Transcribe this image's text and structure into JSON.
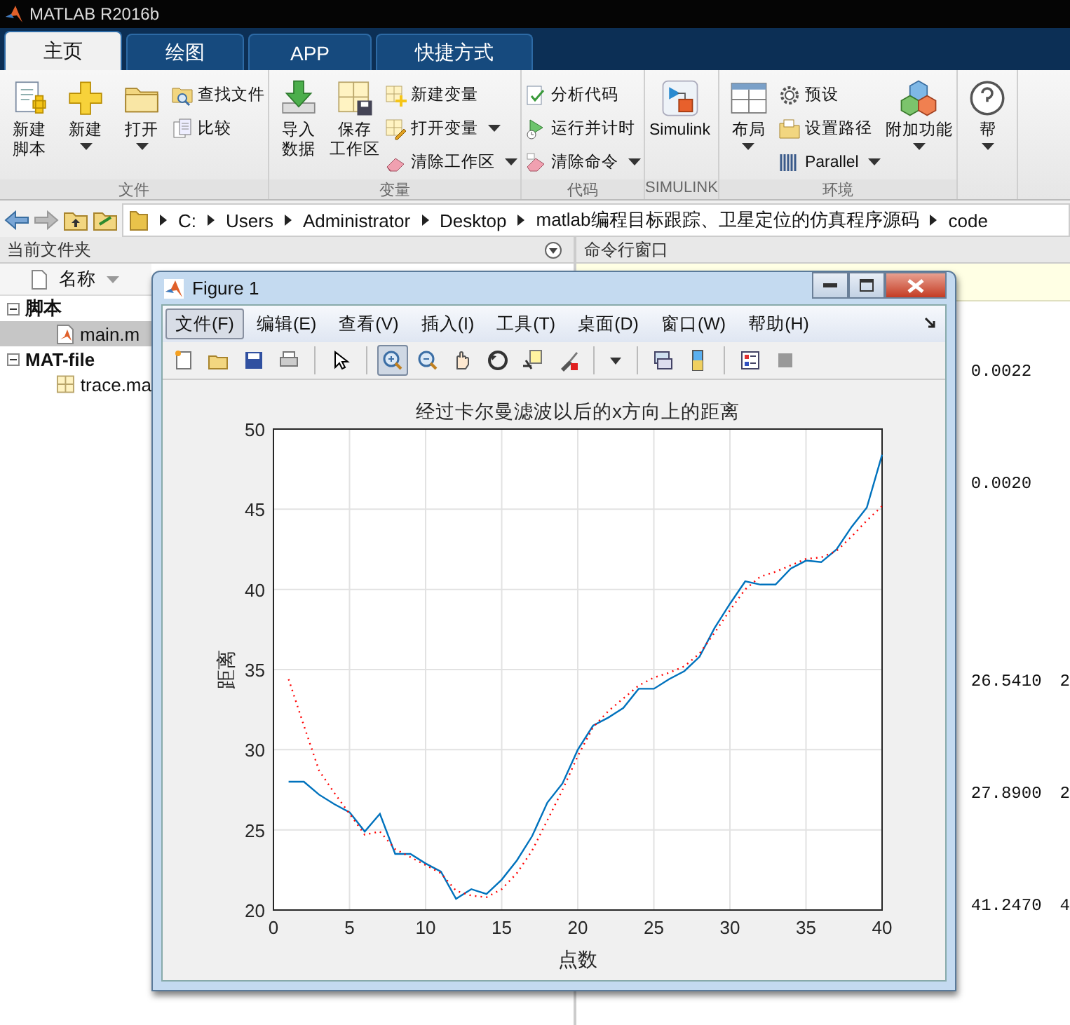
{
  "app_window": {
    "title": "MATLAB R2016b"
  },
  "tabs": [
    {
      "label": "主页",
      "selected": true
    },
    {
      "label": "绘图",
      "selected": false
    },
    {
      "label": "APP",
      "selected": false
    },
    {
      "label": "快捷方式",
      "selected": false
    }
  ],
  "ribbon": {
    "groups": [
      {
        "label": "文件",
        "items": [
          {
            "kind": "large",
            "lines": [
              "新建",
              "脚本"
            ],
            "dropdown": false
          },
          {
            "kind": "large",
            "lines": [
              "新建"
            ],
            "dropdown": true
          },
          {
            "kind": "large",
            "lines": [
              "打开"
            ],
            "dropdown": true
          },
          {
            "kind": "small",
            "label": "查找文件",
            "dropdown": false
          },
          {
            "kind": "small",
            "label": "比较",
            "dropdown": false
          }
        ]
      },
      {
        "label": "变量",
        "items": [
          {
            "kind": "large",
            "lines": [
              "导入",
              "数据"
            ],
            "dropdown": false
          },
          {
            "kind": "large",
            "lines": [
              "保存",
              "工作区"
            ],
            "dropdown": false
          },
          {
            "kind": "small",
            "label": "新建变量",
            "dropdown": false
          },
          {
            "kind": "small",
            "label": "打开变量",
            "dropdown": true
          },
          {
            "kind": "small",
            "label": "清除工作区",
            "dropdown": true
          }
        ]
      },
      {
        "label": "代码",
        "items": [
          {
            "kind": "small",
            "label": "分析代码",
            "dropdown": false
          },
          {
            "kind": "small",
            "label": "运行并计时",
            "dropdown": false
          },
          {
            "kind": "small",
            "label": "清除命令",
            "dropdown": true
          }
        ]
      },
      {
        "label": "SIMULINK",
        "items": [
          {
            "kind": "large",
            "lines": [
              "Simulink"
            ],
            "dropdown": false
          }
        ]
      },
      {
        "label": "环境",
        "items": [
          {
            "kind": "large",
            "lines": [
              "布局"
            ],
            "dropdown": true
          },
          {
            "kind": "small",
            "label": "预设",
            "dropdown": false
          },
          {
            "kind": "small",
            "label": "设置路径",
            "dropdown": false
          },
          {
            "kind": "small",
            "label": "Parallel",
            "dropdown": true
          },
          {
            "kind": "large",
            "lines": [
              "附加功能"
            ],
            "dropdown": true
          }
        ]
      },
      {
        "items": [
          {
            "kind": "large",
            "lines": [
              "帮"
            ],
            "dropdown": true
          }
        ]
      }
    ]
  },
  "address_bar": {
    "path": [
      "C:",
      "Users",
      "Administrator",
      "Desktop",
      "matlab编程目标跟踪、卫星定位的仿真程序源码",
      "code"
    ]
  },
  "file_browser": {
    "title": "当前文件夹",
    "column": "名称",
    "groups": [
      {
        "label": "脚本",
        "expanded": true,
        "children": [
          {
            "name": "main.m",
            "selected": true
          }
        ]
      },
      {
        "label": "MAT-file",
        "expanded": true,
        "children": [
          {
            "name": "trace.ma",
            "selected": false
          }
        ]
      }
    ]
  },
  "command_window": {
    "title": "命令行窗口",
    "rows": [
      [
        "0.0022"
      ],
      [
        "0.0020"
      ],
      [
        "26.5410",
        "2"
      ],
      [
        "27.8900",
        "2"
      ],
      [
        "41.2470",
        "4"
      ]
    ]
  },
  "figure": {
    "title": "Figure 1",
    "menu": [
      {
        "label": "文件(F)",
        "selected": true
      },
      {
        "label": "编辑(E)",
        "selected": false
      },
      {
        "label": "查看(V)",
        "selected": false
      },
      {
        "label": "插入(I)",
        "selected": false
      },
      {
        "label": "工具(T)",
        "selected": false
      },
      {
        "label": "桌面(D)",
        "selected": false
      },
      {
        "label": "窗口(W)",
        "selected": false
      },
      {
        "label": "帮助(H)",
        "selected": false
      }
    ],
    "toolbar": [
      {
        "kind": "button",
        "selected": false
      },
      {
        "kind": "button",
        "selected": false
      },
      {
        "kind": "button",
        "selected": false
      },
      {
        "kind": "button",
        "selected": false
      },
      {
        "kind": "separator"
      },
      {
        "kind": "button",
        "selected": false
      },
      {
        "kind": "separator"
      },
      {
        "kind": "button",
        "selected": true
      },
      {
        "kind": "button",
        "selected": false
      },
      {
        "kind": "button",
        "selected": false
      },
      {
        "kind": "button",
        "selected": false
      },
      {
        "kind": "button",
        "selected": false
      },
      {
        "kind": "button",
        "selected": false
      },
      {
        "kind": "separator"
      },
      {
        "kind": "button",
        "selected": false
      },
      {
        "kind": "separator"
      },
      {
        "kind": "button",
        "selected": false
      },
      {
        "kind": "button",
        "selected": false
      },
      {
        "kind": "separator"
      },
      {
        "kind": "button",
        "selected": false
      },
      {
        "kind": "button",
        "selected": false
      }
    ],
    "chart_data": {
      "type": "line",
      "title": "经过卡尔曼滤波以后的x方向上的距离",
      "xlabel": "点数",
      "ylabel": "距离",
      "x": [
        1,
        2,
        3,
        4,
        5,
        6,
        7,
        8,
        9,
        10,
        11,
        12,
        13,
        14,
        15,
        16,
        17,
        18,
        19,
        20,
        21,
        22,
        23,
        24,
        25,
        26,
        27,
        28,
        29,
        30,
        31,
        32,
        33,
        34,
        35,
        36,
        37,
        38,
        39,
        40
      ],
      "series": [
        {
          "color": "#0072bd",
          "line_style": "solid",
          "values": [
            28.0,
            28.0,
            27.2,
            26.6,
            26.1,
            24.9,
            26.0,
            23.5,
            23.5,
            22.9,
            22.4,
            20.7,
            21.3,
            21.0,
            21.9,
            23.1,
            24.6,
            26.7,
            27.9,
            30.0,
            31.5,
            32.0,
            32.6,
            33.8,
            33.8,
            34.4,
            34.9,
            35.8,
            37.6,
            39.1,
            40.5,
            40.3,
            40.3,
            41.3,
            41.8,
            41.7,
            42.5,
            43.9,
            45.1,
            48.4
          ]
        },
        {
          "color": "#ff0000",
          "line_style": "dotted",
          "values": [
            34.4,
            31.5,
            28.7,
            27.3,
            26.0,
            24.7,
            24.9,
            23.8,
            23.3,
            22.8,
            22.3,
            21.2,
            20.9,
            20.8,
            21.3,
            22.3,
            23.7,
            25.6,
            27.5,
            29.6,
            31.4,
            32.4,
            33.2,
            34.0,
            34.5,
            34.8,
            35.2,
            36.0,
            37.3,
            38.7,
            40.0,
            40.8,
            41.1,
            41.5,
            41.9,
            42.0,
            42.4,
            43.3,
            44.3,
            45.2
          ]
        }
      ],
      "xlim": [
        0,
        40
      ],
      "ylim": [
        20,
        50
      ],
      "xticks": [
        0,
        5,
        10,
        15,
        20,
        25,
        30,
        35,
        40
      ],
      "yticks": [
        20,
        25,
        30,
        35,
        40,
        45,
        50
      ],
      "grid": true
    }
  }
}
